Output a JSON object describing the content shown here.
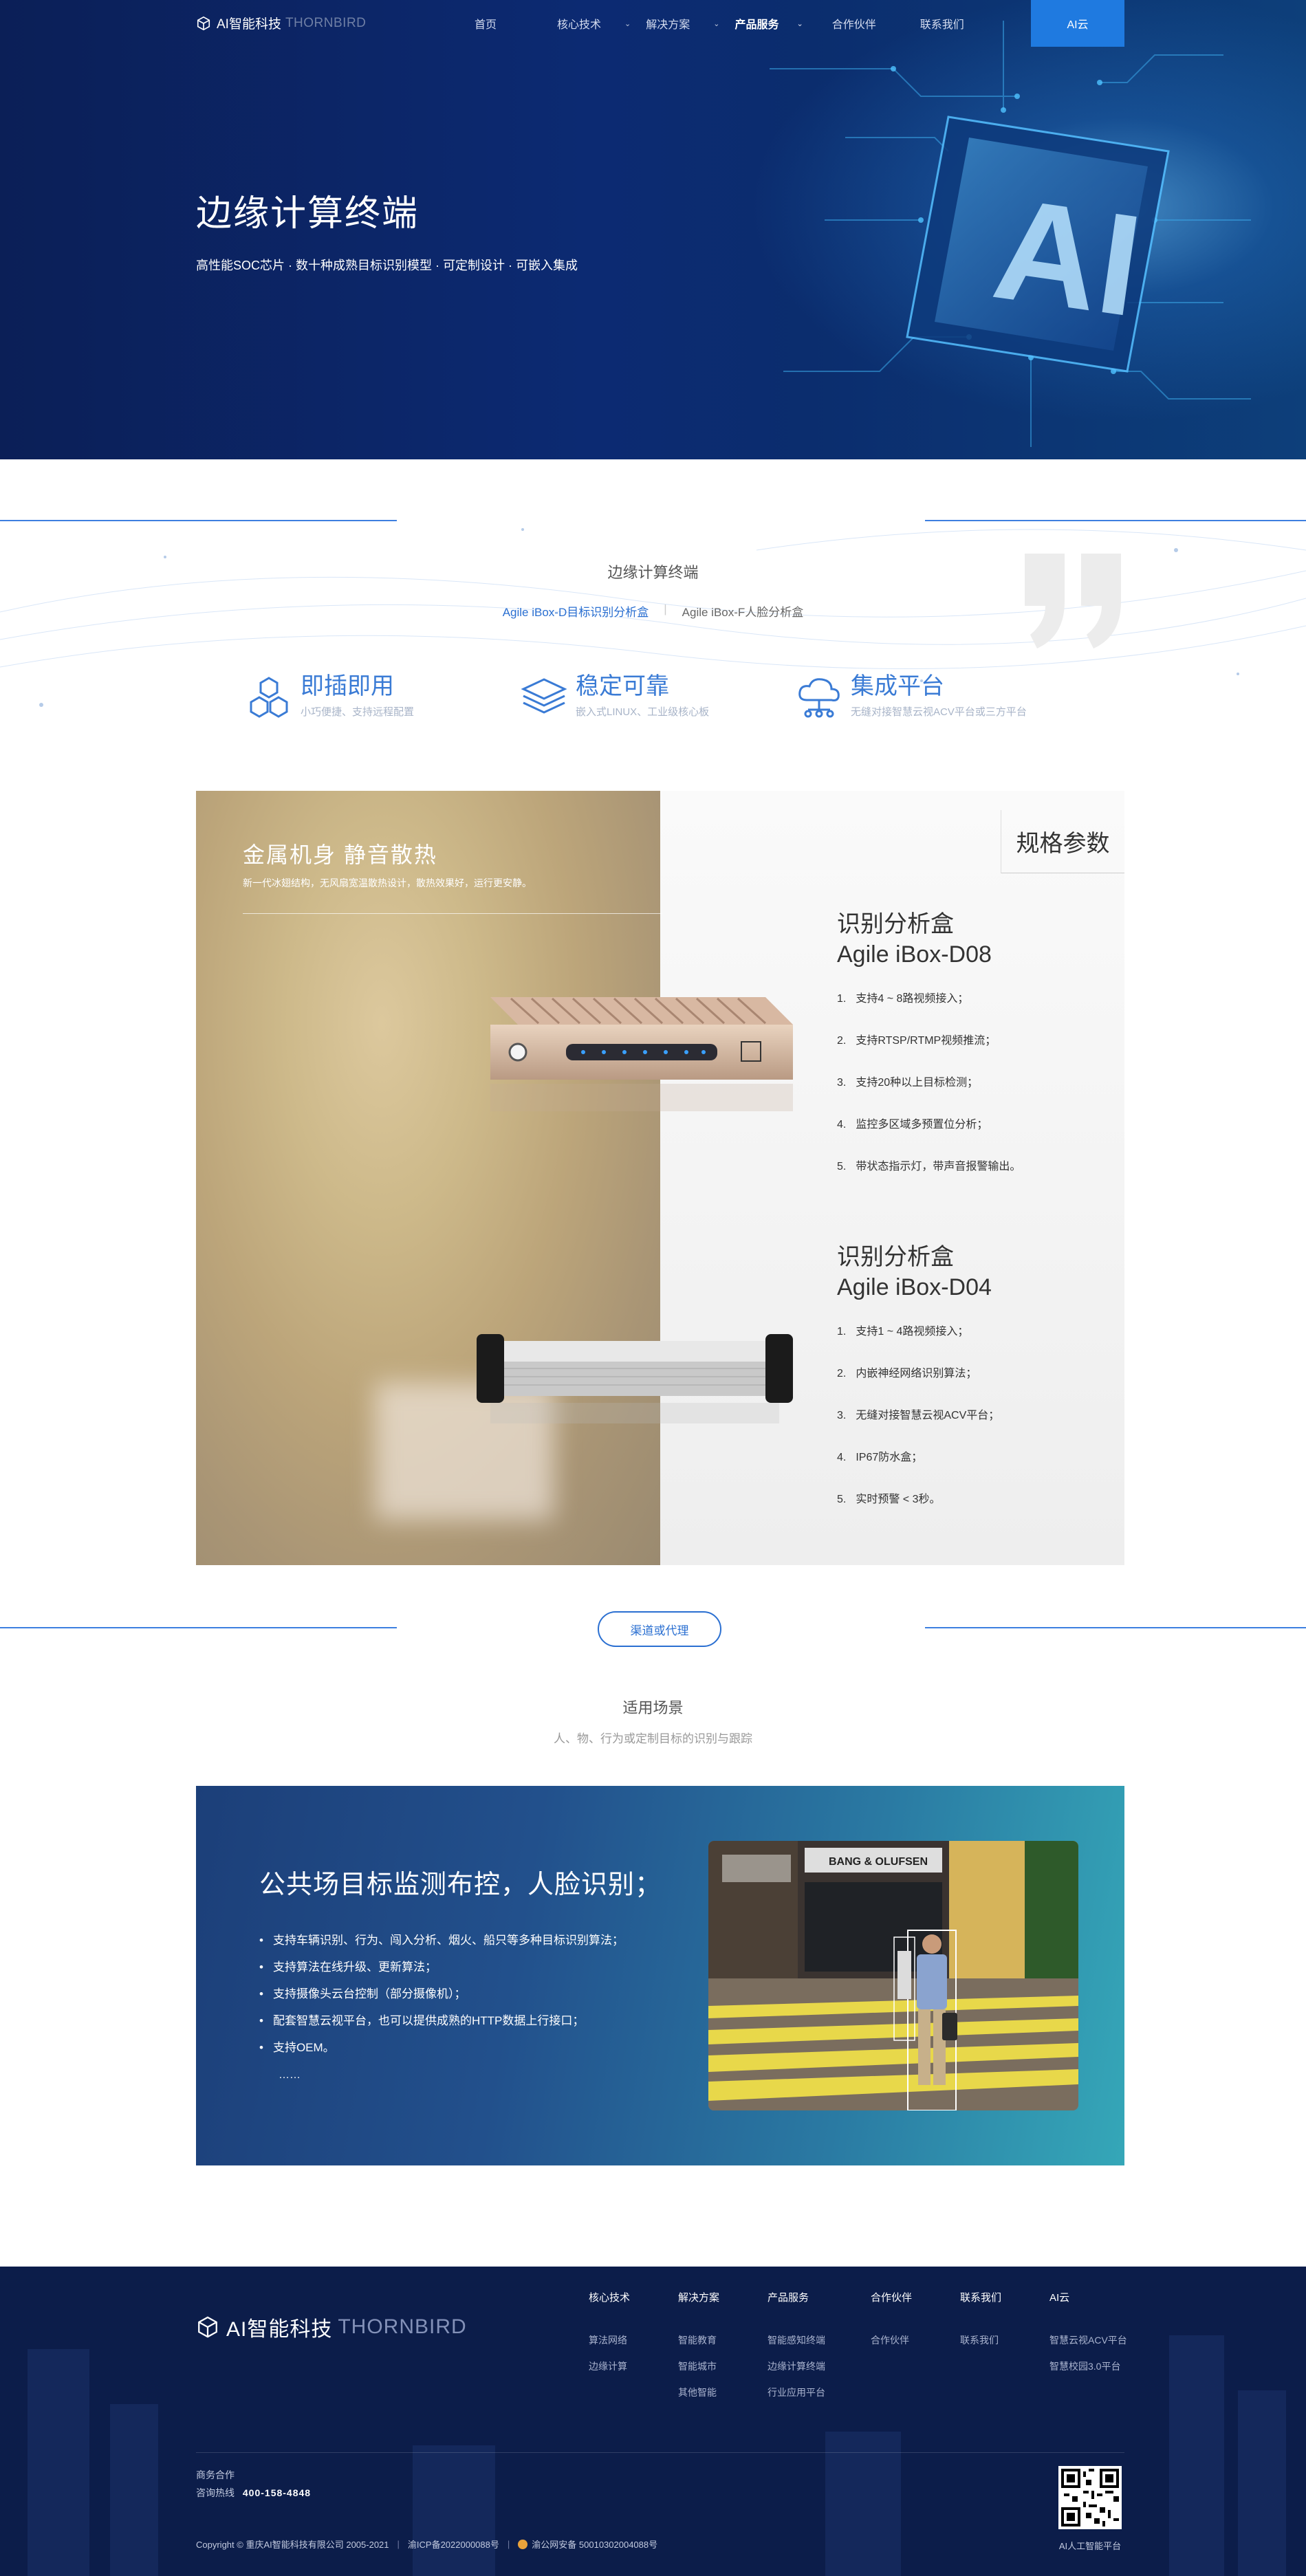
{
  "nav": {
    "brand_cn": "AI智能科技",
    "brand_en": "THORNBIRD",
    "items": [
      {
        "label": "首页",
        "dropdown": false,
        "active": false
      },
      {
        "label": "核心技术",
        "dropdown": true,
        "active": false
      },
      {
        "label": "解决方案",
        "dropdown": true,
        "active": false
      },
      {
        "label": "产品服务",
        "dropdown": true,
        "active": true
      },
      {
        "label": "合作伙伴",
        "dropdown": false,
        "active": false
      },
      {
        "label": "联系我们",
        "dropdown": false,
        "active": false
      }
    ],
    "cloud": "AI云",
    "accent": "#1f7ae0"
  },
  "hero": {
    "title": "边缘计算终端",
    "subtitle": "高性能SOC芯片 · 数十种成熟目标识别模型 · 可定制设计 · 可嵌入集成"
  },
  "intro": {
    "title": "边缘计算终端",
    "tabs": [
      {
        "label": "Agile iBox-D目标识别分析盒",
        "active": true
      },
      {
        "label": "Agile iBox-F人脸分析盒",
        "active": false
      }
    ],
    "features": [
      {
        "icon": "hexagon-cluster-icon",
        "title": "即插即用",
        "desc": "小巧便捷、支持远程配置"
      },
      {
        "icon": "stack-layers-icon",
        "title": "稳定可靠",
        "desc": "嵌入式LINUX、工业级核心板"
      },
      {
        "icon": "cloud-network-icon",
        "title": "集成平台",
        "desc": "无缝对接智慧云视ACV平台或三方平台"
      }
    ]
  },
  "spec": {
    "metal_title": "金属机身 静音散热",
    "metal_desc": "新一代冰翅结构，无风扇宽温散热设计，散热效果好，运行更安静。",
    "label": "规格参数",
    "products": [
      {
        "name_cn": "识别分析盒",
        "name_en": "Agile iBox-D08",
        "features": [
          "支持4 ~ 8路视频接入；",
          "支持RTSP/RTMP视频推流；",
          "支持20种以上目标检测；",
          "监控多区域多预置位分析；",
          "带状态指示灯，带声音报警输出。"
        ]
      },
      {
        "name_cn": "识别分析盒",
        "name_en": "Agile iBox-D04",
        "features": [
          "支持1 ~ 4路视频接入；",
          "内嵌神经网络识别算法；",
          "无缝对接智慧云视ACV平台；",
          "IP67防水盒；",
          "实时预警 < 3秒。"
        ]
      }
    ]
  },
  "agent_button": "渠道或代理",
  "scene": {
    "title": "适用场景",
    "subtitle": "人、物、行为或定制目标的识别与跟踪",
    "card_title": "公共场目标监测布控，人脸识别；",
    "items": [
      "支持车辆识别、行为、闯入分析、烟火、船只等多种目标识别算法；",
      "支持算法在线升级、更新算法；",
      "支持摄像头云台控制（部分摄像机）；",
      "配套智慧云视平台，也可以提供成熟的HTTP数据上行接口；",
      "支持OEM。"
    ],
    "more": "……",
    "photo_sign": "BANG & OLUFSEN"
  },
  "footer": {
    "brand_cn": "AI智能科技",
    "brand_en": "THORNBIRD",
    "columns": [
      {
        "head": "核心技术",
        "links": [
          "算法网络",
          "边缘计算"
        ]
      },
      {
        "head": "解决方案",
        "links": [
          "智能教育",
          "智能城市",
          "其他智能"
        ]
      },
      {
        "head": "产品服务",
        "links": [
          "智能感知终端",
          "边缘计算终端",
          "行业应用平台"
        ]
      },
      {
        "head": "合作伙伴",
        "links": [
          "合作伙伴"
        ]
      },
      {
        "head": "联系我们",
        "links": [
          "联系我们"
        ]
      },
      {
        "head": "AI云",
        "links": [
          "智慧云视ACV平台",
          "智慧校园3.0平台"
        ]
      }
    ],
    "contact_label": "商务合作",
    "hotline_label": "咨询热线",
    "hotline": "400-158-4848",
    "copyright": "Copyright © 重庆AI智能科技有限公司 2005-2021",
    "icp": "渝ICP备2022000088号",
    "police": "渝公网安备 50010302004088号",
    "qr_caption": "AI人工智能平台"
  }
}
